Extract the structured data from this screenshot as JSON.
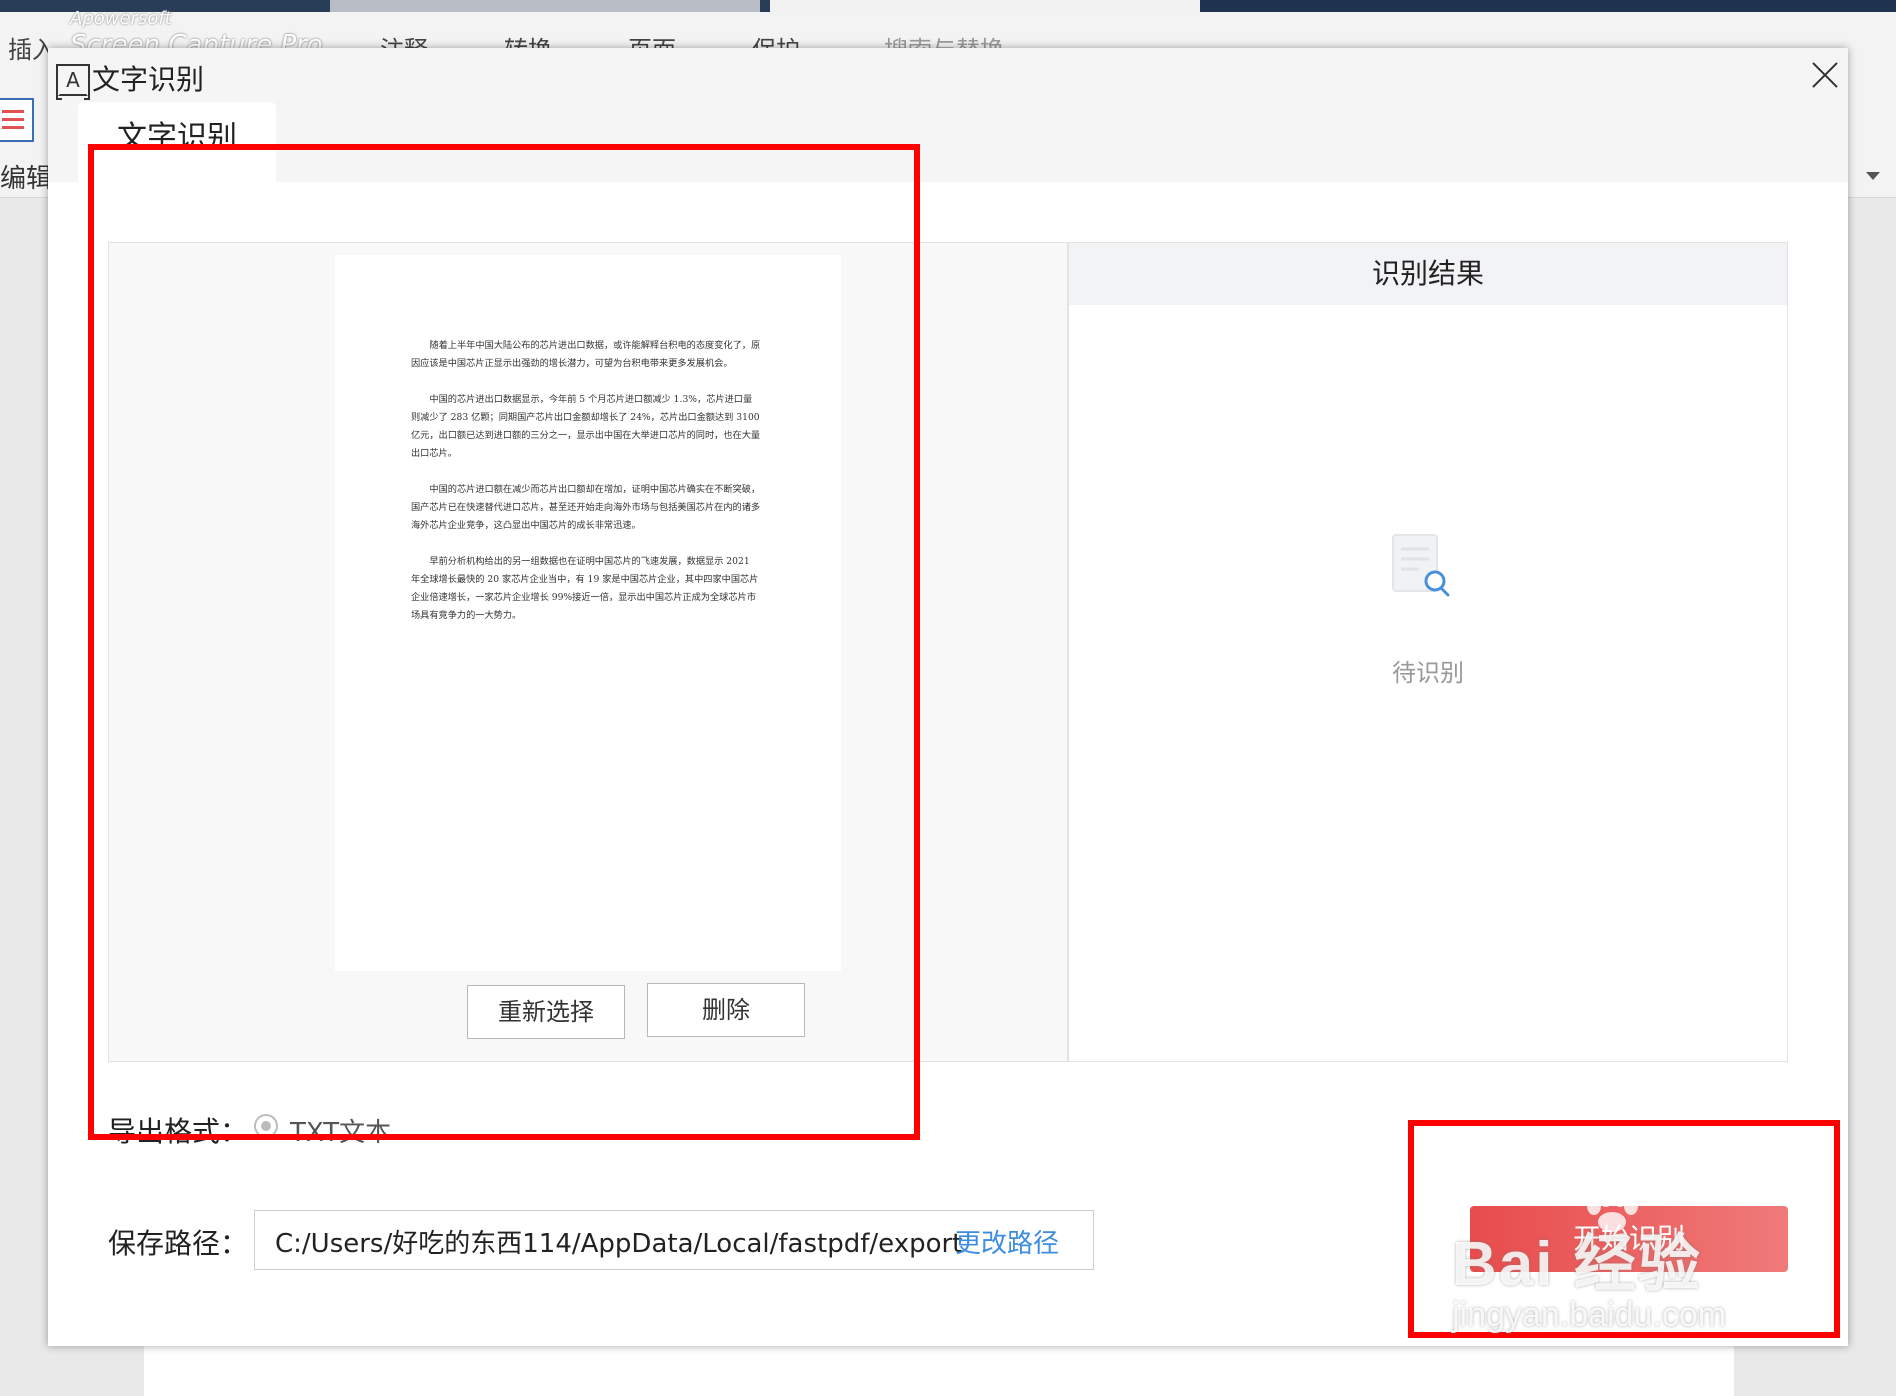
{
  "background_app": {
    "menus": [
      "插入",
      "注释",
      "转换",
      "页面",
      "保护",
      "搜索与替换"
    ],
    "side_label": "编辑",
    "watermark_line1": "Apowersoft",
    "watermark_line2": "Screen Capture Pro"
  },
  "dialog": {
    "title": "文字识别",
    "title_icon_glyph": "A",
    "active_tab": "文字识别",
    "document_paragraphs": [
      "随着上半年中国大陆公布的芯片进出口数据，或许能解释台积电的态度变化了，原因应该是中国芯片正显示出强劲的增长潜力，可望为台积电带来更多发展机会。",
      "中国的芯片进出口数据显示，今年前 5 个月芯片进口额减少 1.3%，芯片进口量则减少了 283 亿颗；同期国产芯片出口金额却增长了 24%，芯片出口金额达到 3100 亿元，出口额已达到进口额的三分之一，显示出中国在大举进口芯片的同时，也在大量出口芯片。",
      "中国的芯片进口额在减少而芯片出口额却在增加，证明中国芯片确实在不断突破，国产芯片已在快速替代进口芯片，甚至还开始走向海外市场与包括美国芯片在内的诸多海外芯片企业竞争，这凸显出中国芯片的成长非常迅速。",
      "早前分析机构给出的另一组数据也在证明中国芯片的飞速发展，数据显示 2021 年全球增长最快的 20 家芯片企业当中，有 19 家是中国芯片企业，其中四家中国芯片企业倍速增长，一家芯片企业增长 99%接近一倍，显示出中国芯片正成为全球芯片市场具有竞争力的一大势力。"
    ],
    "reselect_button": "重新选择",
    "delete_button": "删除",
    "result_header": "识别结果",
    "pending_text": "待识别",
    "export_format_label": "导出格式：",
    "export_format_option": "TXT文本",
    "save_path_label": "保存路径：",
    "save_path_value": "C:/Users/好吃的东西114/AppData/Local/fastpdf/export",
    "change_path_link": "更改路径",
    "start_button": "开始识别"
  },
  "icons": {
    "close": "close-icon",
    "pending": "document-search-icon",
    "title": "text-recognition-icon"
  },
  "colors": {
    "accent_red": "#e84c4c",
    "link_blue": "#3d8de0",
    "annotation_red": "#ff0000"
  },
  "overlay_watermark": {
    "main": "Bai 经验",
    "sub": "jingyan.baidu.com"
  }
}
